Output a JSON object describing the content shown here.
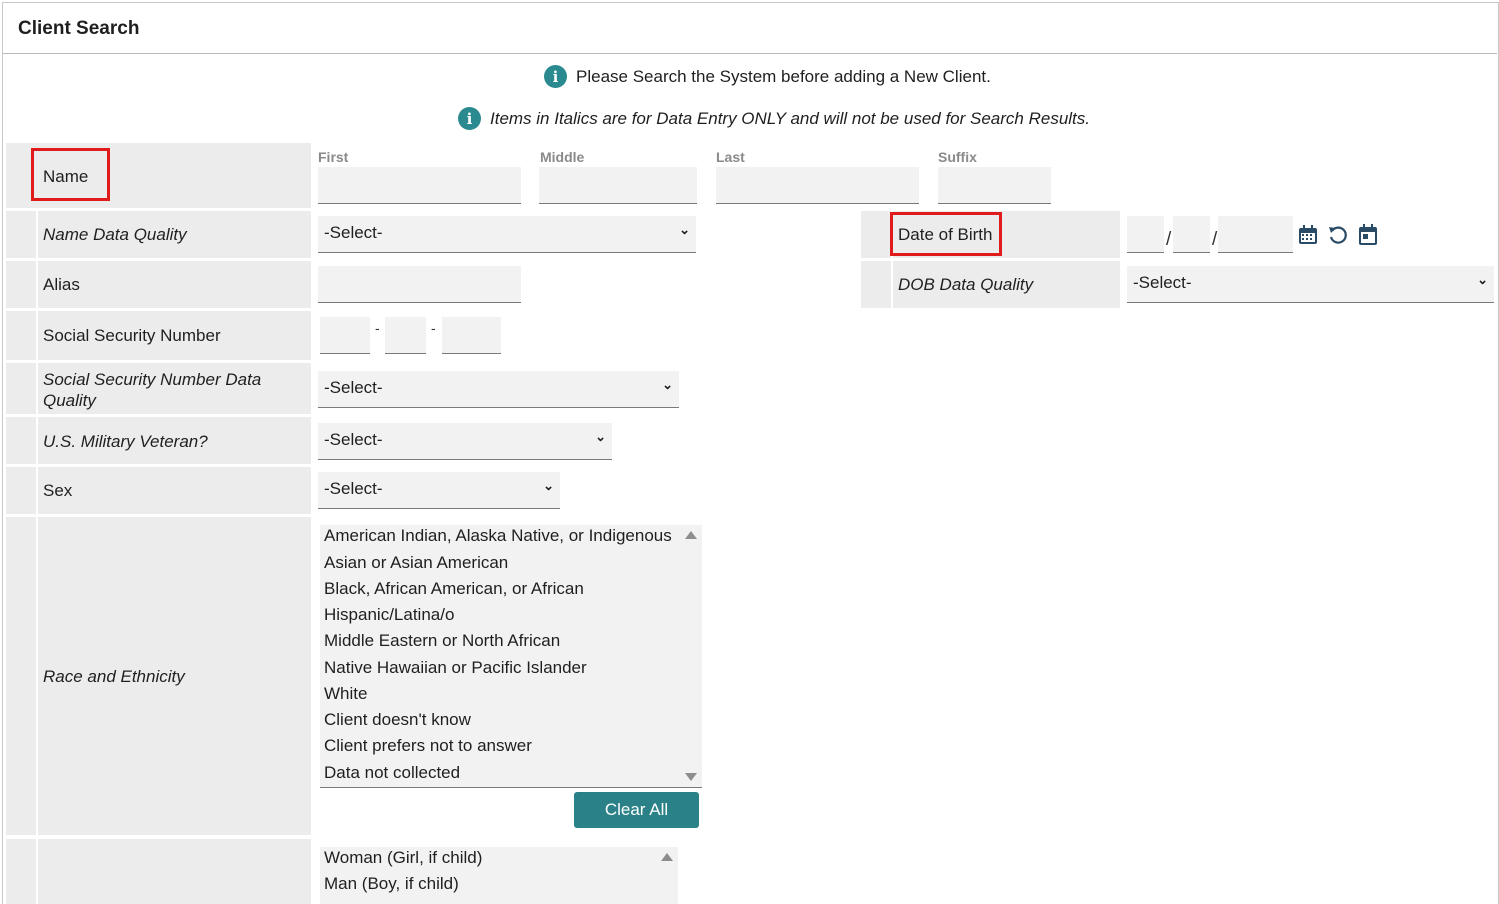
{
  "header": {
    "title": "Client Search"
  },
  "info": {
    "line1": "Please Search the System before adding a New Client.",
    "line2": "Items in Italics are for Data Entry ONLY and will not be used for Search Results."
  },
  "fields": {
    "name": {
      "label": "Name",
      "first": "First",
      "middle": "Middle",
      "last": "Last",
      "suffix": "Suffix"
    },
    "name_data_quality": {
      "label": "Name Data Quality",
      "value": "-Select-"
    },
    "alias": {
      "label": "Alias"
    },
    "ssn": {
      "label": "Social Security Number",
      "sep1": "-",
      "sep2": "-"
    },
    "ssn_data_quality": {
      "label": "Social Security Number Data Quality",
      "value": "-Select-"
    },
    "veteran": {
      "label": "U.S. Military Veteran?",
      "value": "-Select-"
    },
    "sex": {
      "label": "Sex",
      "value": "-Select-"
    },
    "race": {
      "label": "Race and Ethnicity",
      "options": [
        "American Indian, Alaska Native, or Indigenous",
        "Asian or Asian American",
        "Black, African American, or African",
        "Hispanic/Latina/o",
        "Middle Eastern or North African",
        "Native Hawaiian or Pacific Islander",
        "White",
        "Client doesn't know",
        "Client prefers not to answer",
        "Data not collected"
      ],
      "clear_label": "Clear All"
    },
    "gender": {
      "options": [
        "Woman (Girl, if child)",
        "Man (Boy, if child)"
      ]
    },
    "dob": {
      "label": "Date of Birth",
      "sep1": "/",
      "sep2": "/"
    },
    "dob_data_quality": {
      "label": "DOB Data Quality",
      "value": "-Select-"
    }
  },
  "icons": {
    "info": "info-icon",
    "calendar": "calendar-icon",
    "reset": "reset-icon",
    "today": "calendar-today-icon",
    "chevron": "chevron-down-icon"
  },
  "colors": {
    "accent": "#2a8288",
    "highlight": "#e01b1b",
    "label_bg": "#ececec"
  }
}
